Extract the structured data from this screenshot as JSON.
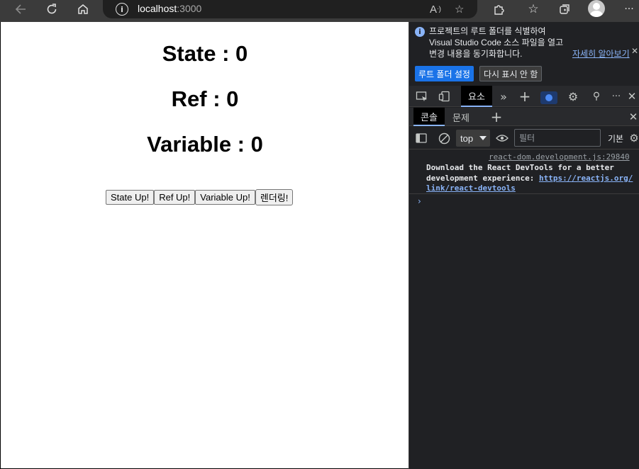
{
  "browser": {
    "url_host": "localhost",
    "url_port": ":3000"
  },
  "page": {
    "state_text": "State : 0",
    "ref_text": "Ref : 0",
    "variable_text": "Variable : 0",
    "buttons": {
      "state_up": "State Up!",
      "ref_up": "Ref Up!",
      "variable_up": "Variable Up!",
      "render": "렌더링!"
    }
  },
  "devtools": {
    "infobar": {
      "line1": "프로젝트의 루트 폴더를 식별하여",
      "line2": "Visual Studio Code 소스 파일을 열고",
      "line3": "변경 내용을 동기화합니다.",
      "link": "자세히 알아보기",
      "primary_button": "루트 폴더 설정",
      "secondary_button": "다시 표시 안 함"
    },
    "tabs": {
      "elements": "요소"
    },
    "drawer": {
      "console_tab": "콘솔",
      "issues_tab": "문제"
    },
    "console": {
      "context": "top",
      "filter_placeholder": "필터",
      "levels": "기본",
      "log_source": "react-dom.development.js:29840",
      "log_line1": "Download the React DevTools for a better",
      "log_line2": "development experience: ",
      "log_link1": "https://reactjs.org/",
      "log_link2": "link/react-devtools"
    }
  },
  "colors": {
    "accent": "#1a73e8",
    "link": "#8ab4f8",
    "devtools_bg": "#202124"
  }
}
